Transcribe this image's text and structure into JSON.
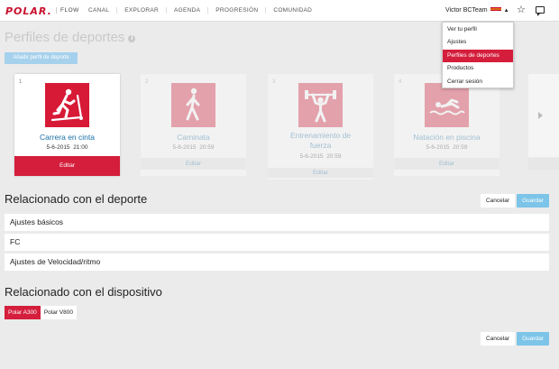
{
  "header": {
    "logo": "POLAR.",
    "product": "FLOW",
    "nav": [
      "CANAL",
      "EXPLORAR",
      "AGENDA",
      "PROGRESIÓN",
      "COMUNIDAD"
    ],
    "user_name": "Victor BCTeam"
  },
  "user_menu": {
    "items": [
      {
        "label": "Ver tu perfil",
        "active": false
      },
      {
        "label": "Ajustes",
        "active": false
      },
      {
        "label": "Perfiles de deportes",
        "active": true
      },
      {
        "label": "Productos",
        "active": false
      },
      {
        "label": "Cerrar sesión",
        "active": false
      }
    ]
  },
  "page": {
    "title": "Perfiles de deportes",
    "add_button": "Añadir perfil de deporte"
  },
  "sport_cards": [
    {
      "number": "1",
      "name_lines": [
        "Carrera en cinta"
      ],
      "date": "5-6-2015",
      "time": "21:00",
      "edit_label": "Editar",
      "icon": "treadmill-icon"
    },
    {
      "number": "2",
      "name_lines": [
        "Caminata"
      ],
      "date": "5-6-2015",
      "time": "20:59",
      "edit_label": "Editar",
      "icon": "walking-icon"
    },
    {
      "number": "3",
      "name_lines": [
        "Entrenamiento de",
        "fuerza"
      ],
      "date": "5-6-2015",
      "time": "20:59",
      "edit_label": "Editar",
      "icon": "weightlifting-icon"
    },
    {
      "number": "4",
      "name_lines": [
        "Natación en piscina"
      ],
      "date": "5-6-2015",
      "time": "20:59",
      "edit_label": "Editar",
      "icon": "swimming-icon"
    }
  ],
  "sport_section": {
    "title": "Relacionado con el deporte",
    "cancel_label": "Cancelar",
    "save_label": "Guardar",
    "rows": [
      "Ajustes básicos",
      "FC",
      "Ajustes de Velocidad/ritmo"
    ]
  },
  "device_section": {
    "title": "Relacionado con el dispositivo",
    "devices": [
      {
        "label": "Polar A300",
        "active": true
      },
      {
        "label": "Polar V800",
        "active": false
      }
    ],
    "cancel_label": "Cancelar",
    "save_label": "Guardar"
  },
  "colors": {
    "brand_red": "#d41e3c",
    "save_blue": "#7cc4e8",
    "link_blue": "#1a6fa8"
  }
}
